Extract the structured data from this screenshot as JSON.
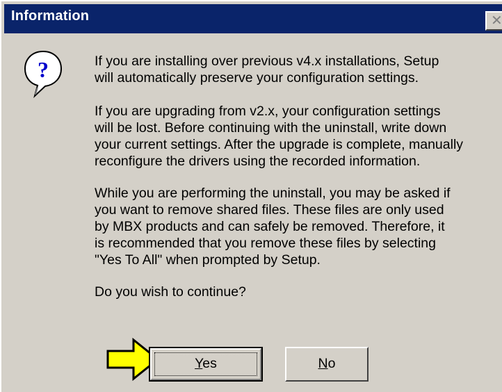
{
  "dialog": {
    "title": "Information",
    "close_glyph": "✕",
    "icon": "question-icon",
    "paragraphs": [
      "If you are installing over previous v4.x installations, Setup\nwill automatically preserve your configuration settings.",
      "If you are upgrading from v2.x, your configuration settings\nwill be lost. Before continuing with the uninstall, write down\nyour current settings. After the upgrade is complete, manually\nreconfigure the drivers using the recorded information.",
      "While you are performing the uninstall, you may be asked if\nyou want to remove shared files. These files are only used\nby MBX products and can safely be removed. Therefore, it\nis recommended that you remove these files by selecting\n\"Yes To All\" when prompted by Setup.",
      "Do you wish to continue?"
    ],
    "buttons": {
      "yes": {
        "mnemonic": "Y",
        "rest": "es"
      },
      "no": {
        "mnemonic": "N",
        "rest": "o"
      }
    }
  },
  "colors": {
    "titlebar": "#0a246a",
    "face": "#d4d0c8",
    "arrow_fill": "#ffff00",
    "icon_bubble": "#ffffff",
    "icon_glyph": "#0000cc"
  },
  "annotation": {
    "arrow_icon": "yellow-arrow-icon"
  }
}
